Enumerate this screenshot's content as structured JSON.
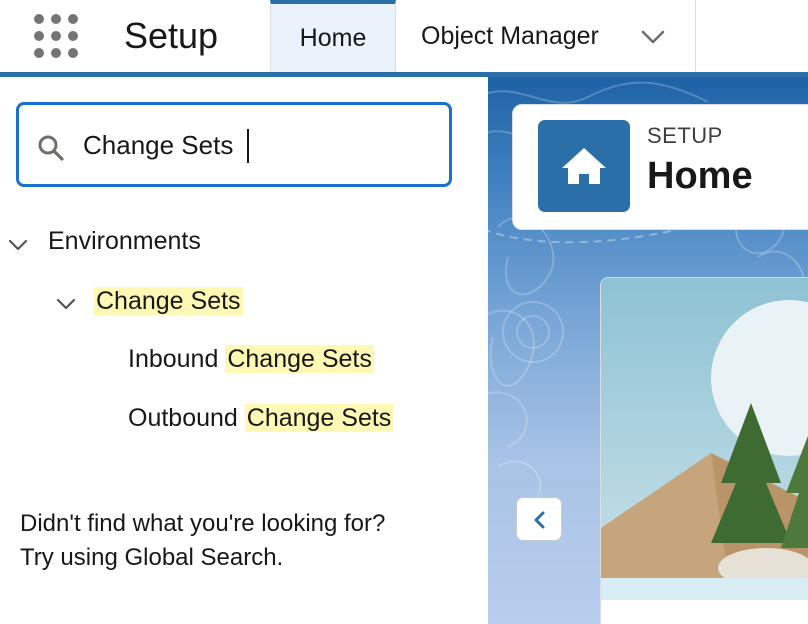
{
  "topbar": {
    "app_title": "Setup",
    "tabs": [
      {
        "label": "Home",
        "active": true
      },
      {
        "label": "Object Manager",
        "active": false
      }
    ],
    "accent_color": "#2a6fa7"
  },
  "quick_find": {
    "value": "Change Sets",
    "border_color": "#1b6fd0"
  },
  "tree": {
    "section_label": "Environments",
    "group": {
      "highlight": "Change Sets",
      "items": [
        {
          "prefix": "Inbound ",
          "highlight": "Change Sets"
        },
        {
          "prefix": "Outbound ",
          "highlight": "Change Sets"
        }
      ]
    },
    "highlight_color": "#fdf8b4"
  },
  "help": {
    "line1": "Didn't find what you're looking for?",
    "line2": "Try using Global Search."
  },
  "setup_header": {
    "eyebrow": "SETUP",
    "title": "Home",
    "icon": "home-icon"
  }
}
